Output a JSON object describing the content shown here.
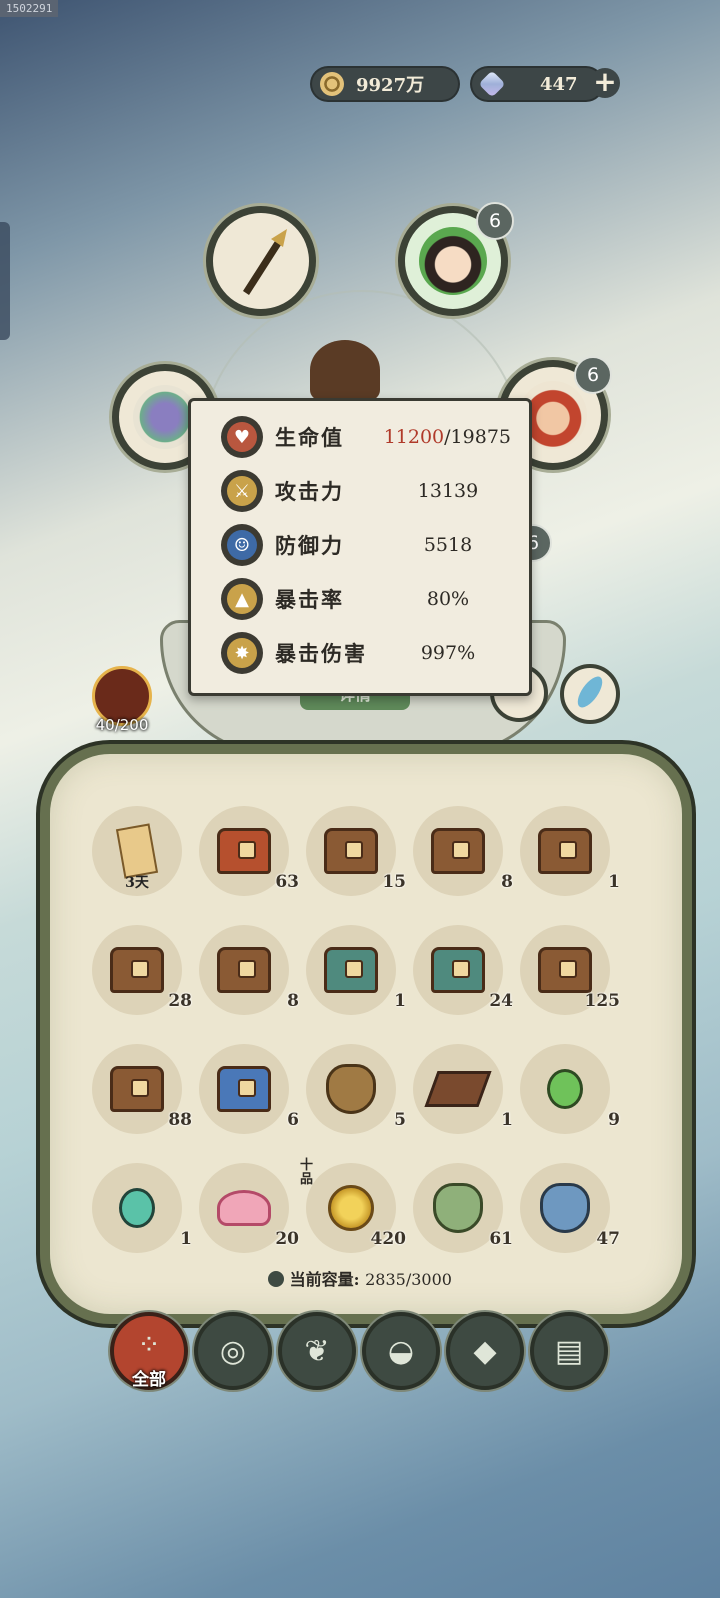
{
  "build_id": "1502291",
  "currency": {
    "coins": "9927万",
    "gems": "447",
    "plus": "+"
  },
  "equip_badges": {
    "companion_top": "6",
    "companion_right": "6",
    "companion_mid": "6"
  },
  "stats": [
    {
      "icon": "heart-icon",
      "label": "生命值",
      "current": "11200",
      "max": "/19875",
      "color": "#b9573f"
    },
    {
      "icon": "sword-icon",
      "label": "攻击力",
      "value": "13139",
      "color": "#c9a24a"
    },
    {
      "icon": "person-icon",
      "label": "防御力",
      "value": "5518",
      "color": "#3e6aa6"
    },
    {
      "icon": "crit-icon",
      "label": "暴击率",
      "value": "80%",
      "color": "#c9a24a"
    },
    {
      "icon": "burst-icon",
      "label": "暴击伤害",
      "value": "997%",
      "color": "#c9a24a"
    }
  ],
  "details_button": "详情",
  "level": "40/200",
  "inventory": {
    "items": [
      {
        "name": "scroll",
        "duration": "3天"
      },
      {
        "name": "chest-red",
        "qty": "63"
      },
      {
        "name": "chest-brown",
        "qty": "15"
      },
      {
        "name": "chest-brown",
        "qty": "8"
      },
      {
        "name": "chest-brown",
        "qty": "1"
      },
      {
        "name": "chest-brown",
        "qty": "28"
      },
      {
        "name": "chest-brown",
        "qty": "8"
      },
      {
        "name": "chest-teal",
        "qty": "1"
      },
      {
        "name": "chest-teal",
        "qty": "24"
      },
      {
        "name": "chest-brown",
        "qty": "125"
      },
      {
        "name": "chest-brown",
        "qty": "88"
      },
      {
        "name": "chest-blue",
        "qty": "6"
      },
      {
        "name": "pouch-brown",
        "qty": "5"
      },
      {
        "name": "tray-spoon",
        "qty": "1"
      },
      {
        "name": "potion-green",
        "qty": "9"
      },
      {
        "name": "potion-teal",
        "qty": "1"
      },
      {
        "name": "lotus",
        "qty": "20"
      },
      {
        "name": "grapes",
        "qty": "420",
        "tag": "十品"
      },
      {
        "name": "pouch-green",
        "qty": "61"
      },
      {
        "name": "pouch-blue",
        "qty": "47"
      }
    ],
    "capacity_label": "当前容量:",
    "capacity_value": "2835/3000"
  },
  "tabs": [
    {
      "icon": "grid-icon",
      "label": "全部",
      "active": true
    },
    {
      "icon": "log-icon"
    },
    {
      "icon": "herb-icon"
    },
    {
      "icon": "bowl-icon"
    },
    {
      "icon": "ore-icon"
    },
    {
      "icon": "scroll-icon"
    }
  ]
}
